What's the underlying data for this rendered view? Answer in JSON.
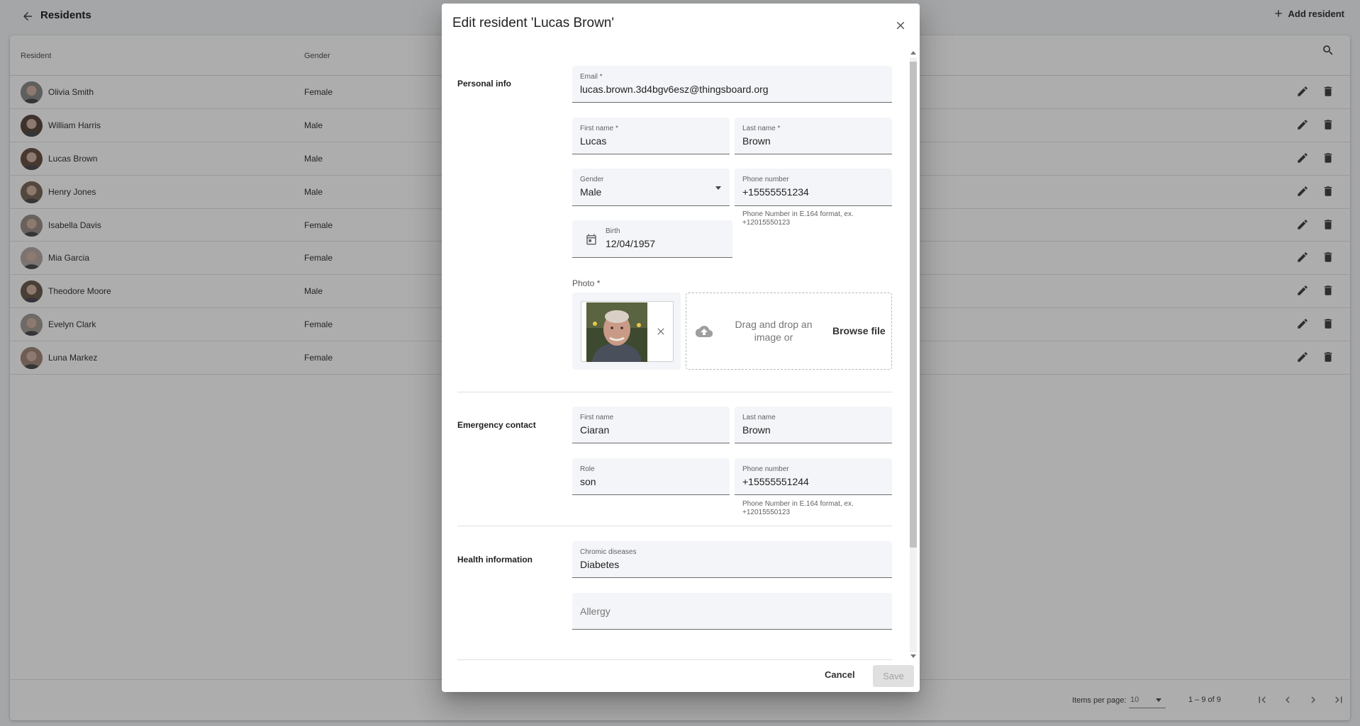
{
  "header": {
    "title": "Residents",
    "add_label": "Add resident"
  },
  "table": {
    "columns": [
      "Resident",
      "Gender"
    ],
    "rows": [
      {
        "name": "Olivia Smith",
        "gender": "Female"
      },
      {
        "name": "William Harris",
        "gender": "Male"
      },
      {
        "name": "Lucas Brown",
        "gender": "Male"
      },
      {
        "name": "Henry Jones",
        "gender": "Male"
      },
      {
        "name": "Isabella Davis",
        "gender": "Female"
      },
      {
        "name": "Mia Garcia",
        "gender": "Female"
      },
      {
        "name": "Theodore Moore",
        "gender": "Male"
      },
      {
        "name": "Evelyn Clark",
        "gender": "Female"
      },
      {
        "name": "Luna Markez",
        "gender": "Female"
      }
    ]
  },
  "paginator": {
    "items_per_page_label": "Items per page:",
    "items_per_page": "10",
    "range": "1 – 9 of 9"
  },
  "dialog": {
    "title": "Edit resident 'Lucas Brown'",
    "personal": {
      "section": "Personal info",
      "email_label": "Email *",
      "email": "lucas.brown.3d4bgv6esz@thingsboard.org",
      "first_name_label": "First name *",
      "first_name": "Lucas",
      "last_name_label": "Last name *",
      "last_name": "Brown",
      "gender_label": "Gender",
      "gender": "Male",
      "phone_label": "Phone number",
      "phone": "+15555551234",
      "phone_hint": "Phone Number in E.164 format, ex. +12015550123",
      "birth_label": "Birth",
      "birth": "12/04/1957",
      "photo_label": "Photo *",
      "dropzone_text": "Drag and drop an image or",
      "browse_label": "Browse file"
    },
    "emergency": {
      "section": "Emergency contact",
      "first_name_label": "First name",
      "first_name": "Ciaran",
      "last_name_label": "Last name",
      "last_name": "Brown",
      "role_label": "Role",
      "role": "son",
      "phone_label": "Phone number",
      "phone": "+15555551244",
      "phone_hint": "Phone Number in E.164 format, ex. +12015550123"
    },
    "health": {
      "section": "Health information",
      "chronic_label": "Chromic diseases",
      "chronic": "Diabetes",
      "allergy_placeholder": "Allergy"
    },
    "cancel_label": "Cancel",
    "save_label": "Save"
  },
  "colors": {
    "field_bg": "#f3f5f8",
    "overlay": "rgba(0,0,0,0.32)",
    "save_disabled_bg": "#e0e0e0"
  },
  "icons": [
    "arrow-back-icon",
    "add-icon",
    "search-icon",
    "edit-icon",
    "delete-icon",
    "close-icon",
    "calendar-icon",
    "cloud-upload-icon",
    "first-page-icon",
    "prev-page-icon",
    "next-page-icon",
    "last-page-icon"
  ]
}
